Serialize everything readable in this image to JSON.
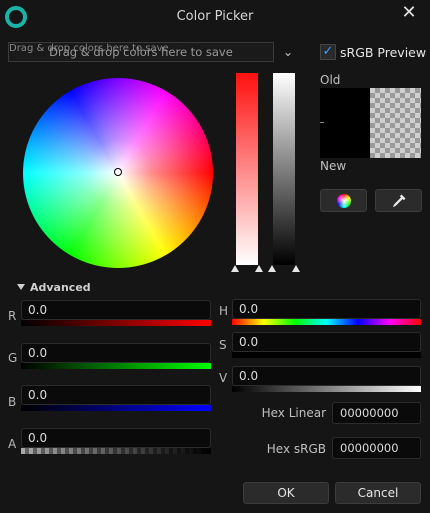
{
  "window": {
    "title": "Color Picker",
    "close_glyph": "✕"
  },
  "dropzone": {
    "small_text": "Drag & drop colors here to save",
    "main_text": "Drag & drop colors here to save",
    "chevron": "⌄"
  },
  "srgb_preview": {
    "label": "sRGB Preview",
    "checked": true,
    "check_glyph": "✓"
  },
  "preview": {
    "old_label": "Old",
    "new_label": "New",
    "old_color": "#000000"
  },
  "tools": {
    "eyedropper_glyph": "✎"
  },
  "advanced": {
    "label": "Advanced"
  },
  "channels": {
    "r": {
      "label": "R",
      "value": "0.0"
    },
    "g": {
      "label": "G",
      "value": "0.0"
    },
    "b": {
      "label": "B",
      "value": "0.0"
    },
    "a": {
      "label": "A",
      "value": "0.0"
    },
    "h": {
      "label": "H",
      "value": "0.0"
    },
    "s": {
      "label": "S",
      "value": "0.0"
    },
    "v": {
      "label": "V",
      "value": "0.0"
    }
  },
  "hex": {
    "linear": {
      "label": "Hex Linear",
      "value": "00000000"
    },
    "srgb": {
      "label": "Hex sRGB",
      "value": "00000000"
    }
  },
  "buttons": {
    "ok": "OK",
    "cancel": "Cancel"
  },
  "colors": {
    "accent": "#3aa0ff",
    "logo": "#1ab3a8",
    "background": "#151515"
  }
}
